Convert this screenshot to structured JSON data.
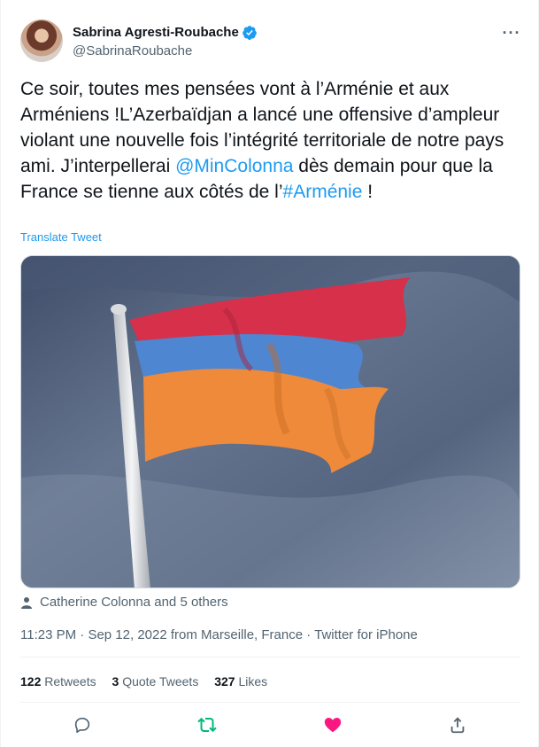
{
  "author": {
    "display_name": "Sabrina Agresti-Roubache",
    "handle": "@SabrinaRoubache",
    "verified": true
  },
  "tweet": {
    "text_part1": "Ce soir, toutes mes pensées vont à l’Arménie et aux Arméniens !L’Azerbaïdjan a lancé une offensive d’ampleur violant une nouvelle fois l’intégrité territoriale de notre pays ami. J’interpellerai ",
    "mention": "@MinColonna",
    "text_part2": " dès demain pour que la France se tienne aux côtés de l’",
    "hashtag": "#Arménie",
    "text_part3": " !",
    "translate_label": "Translate Tweet"
  },
  "media": {
    "description_icon": "flag-photo",
    "flag_colors": [
      "#d6304a",
      "#4e86d2",
      "#ef8a3b"
    ]
  },
  "tagged": {
    "text": "Catherine Colonna and 5 others"
  },
  "meta": {
    "time": "11:23 PM",
    "sep1": " · ",
    "date": "Sep 12, 2022",
    "location": " from Marseille, France",
    "sep2": " · ",
    "client": "Twitter for iPhone"
  },
  "stats": {
    "retweets_count": "122",
    "retweets_label": "Retweets",
    "quotes_count": "3",
    "quotes_label": "Quote Tweets",
    "likes_count": "327",
    "likes_label": "Likes"
  },
  "actions": {
    "reply_icon": "reply-icon",
    "retweet_icon": "retweet-icon",
    "like_icon": "heart-icon",
    "share_icon": "share-icon",
    "like_color": "#f91880",
    "retweet_color": "#00ba7c"
  }
}
